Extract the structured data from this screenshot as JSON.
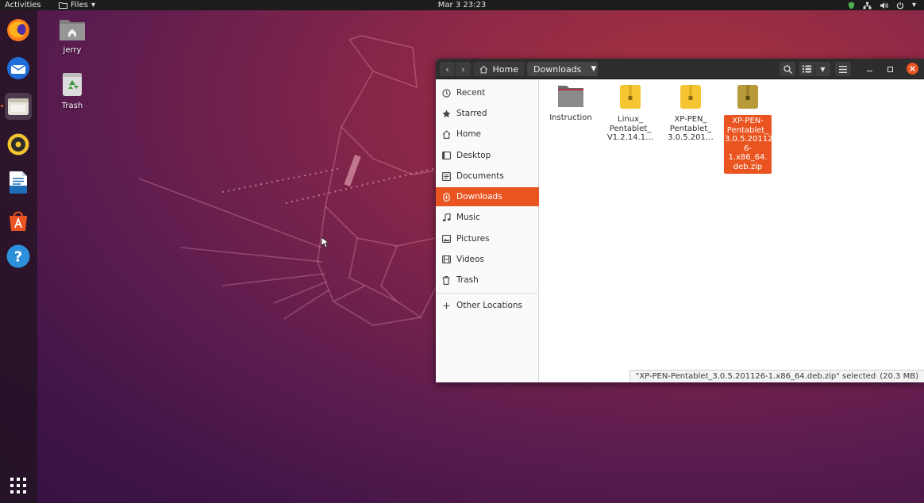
{
  "topbar": {
    "activities": "Activities",
    "app_menu": "Files",
    "clock": "Mar 3  23:23",
    "tray_icons": [
      "shield-icon",
      "network-icon",
      "volume-icon",
      "power-icon",
      "chevron-down-icon"
    ]
  },
  "dock": {
    "items": [
      {
        "name": "firefox",
        "icon": "firefox-icon"
      },
      {
        "name": "thunderbird",
        "icon": "thunderbird-icon"
      },
      {
        "name": "files",
        "icon": "files-icon",
        "active": true
      },
      {
        "name": "rhythmbox",
        "icon": "rhythmbox-icon"
      },
      {
        "name": "libreoffice-writer",
        "icon": "writer-icon"
      },
      {
        "name": "ubuntu-software",
        "icon": "software-icon"
      },
      {
        "name": "help",
        "icon": "help-icon"
      }
    ],
    "show_apps_icon": "grid-icon"
  },
  "desktop": {
    "icons": [
      {
        "label": "jerry",
        "icon": "home-folder-icon"
      },
      {
        "label": "Trash",
        "icon": "trash-icon"
      }
    ]
  },
  "window": {
    "path": {
      "home": "Home",
      "current": "Downloads"
    },
    "sidebar": {
      "items": [
        {
          "label": "Recent",
          "icon": "clock-icon"
        },
        {
          "label": "Starred",
          "icon": "star-icon"
        },
        {
          "label": "Home",
          "icon": "home-icon"
        },
        {
          "label": "Desktop",
          "icon": "desktop-icon"
        },
        {
          "label": "Documents",
          "icon": "documents-icon"
        },
        {
          "label": "Downloads",
          "icon": "download-icon",
          "selected": true
        },
        {
          "label": "Music",
          "icon": "music-icon"
        },
        {
          "label": "Pictures",
          "icon": "pictures-icon"
        },
        {
          "label": "Videos",
          "icon": "videos-icon"
        },
        {
          "label": "Trash",
          "icon": "trash-icon"
        }
      ],
      "other_locations": "Other Locations"
    },
    "files": [
      {
        "l1": "Instruction",
        "l2": "",
        "l3": "",
        "l4": "",
        "type": "folder"
      },
      {
        "l1": "Linux_",
        "l2": "Pentablet_",
        "l3": "V1.2.14.1…",
        "l4": "",
        "type": "zip"
      },
      {
        "l1": "XP-PEN_",
        "l2": "Pentablet_",
        "l3": "3.0.5.201…",
        "l4": "",
        "type": "zip"
      },
      {
        "l1": "XP-PEN-",
        "l2": "Pentablet_",
        "l3": "3.0.5.20112",
        "l4": "6-1.x86_64.",
        "l5": "deb.zip",
        "type": "zip",
        "selected": true
      }
    ],
    "status": {
      "text": "\"XP-PEN-Pentablet_3.0.5.201126-1.x86_64.deb.zip\" selected",
      "size": "(20.3 MB)"
    }
  },
  "colors": {
    "accent": "#e95420",
    "headerbar": "#2d2d2d",
    "topbar": "#1c1c1c"
  }
}
